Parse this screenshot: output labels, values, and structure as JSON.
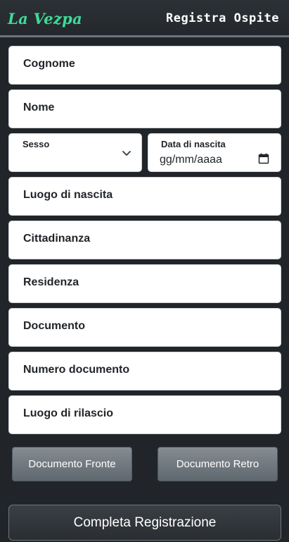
{
  "header": {
    "brand": "La Vezpa",
    "title": "Registra Ospite"
  },
  "form": {
    "cognome": "Cognome",
    "nome": "Nome",
    "sesso": {
      "label": "Sesso",
      "value": ""
    },
    "data_nascita": {
      "label": "Data di nascita",
      "placeholder": "gg/mm/aaaa"
    },
    "luogo_nascita": "Luogo di nascita",
    "cittadinanza": "Cittadinanza",
    "residenza": "Residenza",
    "documento": "Documento",
    "numero_documento": "Numero documento",
    "luogo_rilascio": "Luogo di rilascio"
  },
  "buttons": {
    "fronte": "Documento Fronte",
    "retro": "Documento Retro",
    "submit": "Completa Registrazione"
  },
  "colors": {
    "brand": "#3ddc97",
    "background": "#212529",
    "field": "#ffffff",
    "button": "#6c757d"
  }
}
